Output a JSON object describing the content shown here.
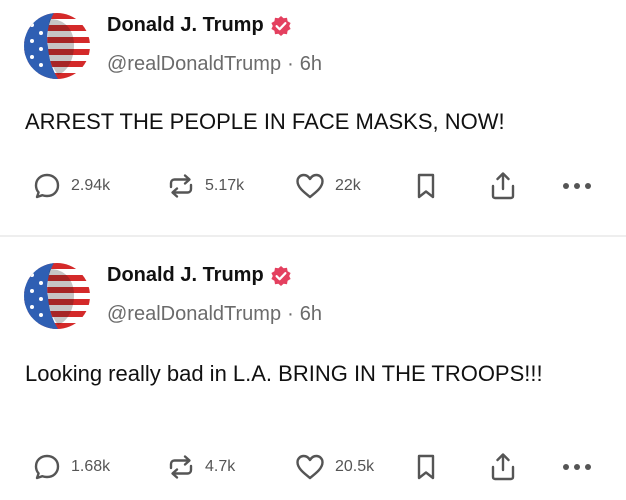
{
  "posts": [
    {
      "author_name": "Donald J. Trump",
      "handle": "@realDonaldTrump",
      "separator": "·",
      "time": "6h",
      "text": "ARREST THE PEOPLE IN FACE MASKS, NOW!",
      "replies": "2.94k",
      "reposts": "5.17k",
      "likes": "22k"
    },
    {
      "author_name": "Donald J. Trump",
      "handle": "@realDonaldTrump",
      "separator": "·",
      "time": "6h",
      "text": "Looking really bad in L.A. BRING IN THE TROOPS!!!",
      "replies": "1.68k",
      "reposts": "4.7k",
      "likes": "20.5k"
    }
  ],
  "icons": {
    "verified": "verified-badge-icon",
    "reply": "comment-bubble-icon",
    "repost": "repost-arrows-icon",
    "like": "heart-icon",
    "bookmark": "bookmark-icon",
    "share": "share-upload-icon",
    "more": "more-dots-icon"
  },
  "colors": {
    "verified_badge": "#e4405f",
    "icon_stroke": "#555555",
    "text": "#111111",
    "muted": "#6b6b6b",
    "divider": "#eeeeee"
  }
}
